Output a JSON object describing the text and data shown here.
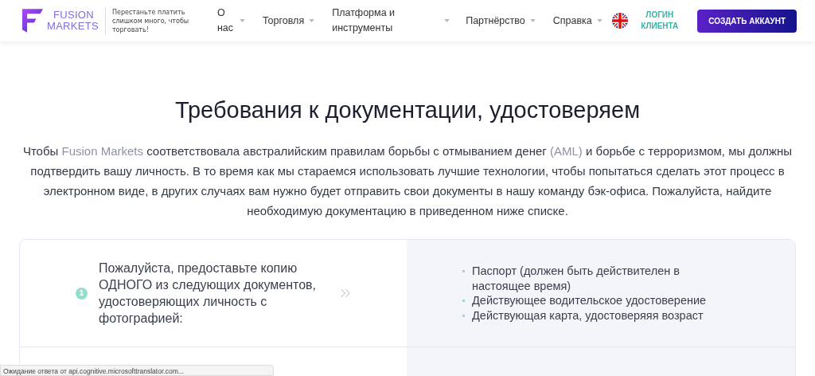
{
  "header": {
    "logo": {
      "line1": "FUSION",
      "line2": "MARKETS"
    },
    "tagline": "Перестаньте платить слишком много, чтобы торговать!",
    "nav": [
      {
        "label": "О нас"
      },
      {
        "label": "Торговля"
      },
      {
        "label": "Платформа и инструменты"
      },
      {
        "label": "Партнёрство"
      },
      {
        "label": "Справка"
      }
    ],
    "login": "ЛОГИН КЛИЕНТА",
    "cta": "СОЗДАТЬ АККАУНТ"
  },
  "title": "Требования к документации, удостоверяем",
  "intro": [
    {
      "text": "Чтобы ",
      "light": false
    },
    {
      "text": "Fusion Markets",
      "light": true
    },
    {
      "text": " соответствовала австралийским правилам борьбы с отмыванием денег ",
      "light": false
    },
    {
      "text": "(AML)",
      "light": true
    },
    {
      "text": " и борьбе с терроризмом, мы должны подтвердить вашу личность. В то время как мы стараемся использовать лучшие технологии, чтобы попытаться сделать этот процесс в электронном виде, в других случаях вам нужно будет отправить свои документы в нашу команду бэк-офиса. Пожалуйста, найдите необходимую документацию в приведенном ниже списке.",
      "light": false
    }
  ],
  "requirements": [
    {
      "number": "1",
      "text": "Пожалуйста, предоставьте копию ОДНОГО из следующих документов, удостоверяющих личность с фотографией:",
      "items": [
        "Паспорт (должен быть действителен в настоящее время)",
        "Действующее водительское удостоверение",
        "Действующая карта, удостоверяяя возраст"
      ]
    }
  ],
  "status_bar": "Ожидание ответа от api.cognitive.microsofttranslator.com..."
}
